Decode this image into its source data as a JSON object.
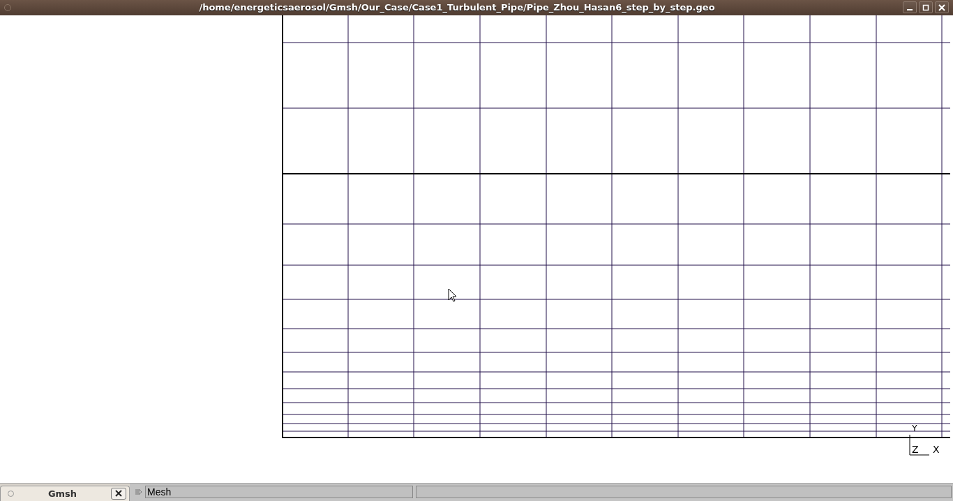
{
  "window": {
    "title": "/home/energeticsaerosol/Gmsh/Our_Case/Case1_Turbulent_Pipe/Pipe_Zhou_Hasan6_step_by_step.geo"
  },
  "axes": {
    "y_label": "Y",
    "z_label": "Z",
    "x_label": "X"
  },
  "taskbar": {
    "tab": {
      "label": "Gmsh",
      "selected": true
    }
  },
  "status_bar": {
    "message": "Mesh"
  }
}
